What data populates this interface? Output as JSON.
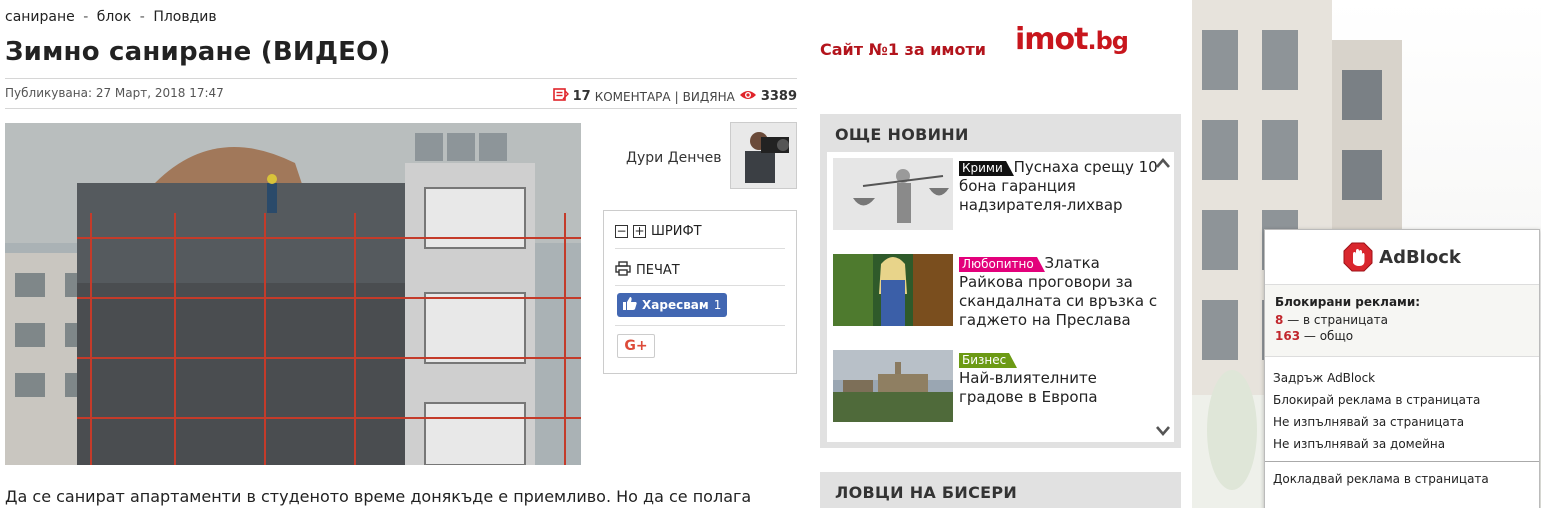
{
  "article": {
    "tags": [
      "саниране",
      "блок",
      "Пловдив"
    ],
    "tag_separator": "-",
    "title": "Зимно саниране (ВИДЕО)",
    "published": "Публикувана: 27 Март, 2018 17:47",
    "comments_count": "17",
    "comments_label": "КОМЕНТАРА",
    "stats_separator": "|",
    "views_label": "ВИДЯНА",
    "views_count": "3389",
    "author": "Дури Денчев",
    "lead": "Да се санират апартаменти в студеното време донякъде е приемливо. Но да се полага"
  },
  "tools": {
    "font_label": "ШРИФТ",
    "print_label": "ПЕЧАТ",
    "like_label": "Харесвам",
    "like_count": "1",
    "gplus_label": "G+"
  },
  "promo": {
    "text": "Сайт №1 за имоти",
    "logo_main": "imot",
    "logo_domain": ".bg"
  },
  "news": {
    "header": "ОЩЕ НОВИНИ",
    "items": [
      {
        "category": "Крими",
        "category_color": "#111111",
        "title": "Пуснаха срещу 10 бона гаранция надзирателя-лихвар"
      },
      {
        "category": "Любопитно",
        "category_color": "#e3007b",
        "title": "Златка Райкова проговори за скандалната си връзка с гаджето на Преслава"
      },
      {
        "category": "Бизнес",
        "category_color": "#6c9a14",
        "title": "Най-влиятелните градове в Европа"
      }
    ]
  },
  "hunters": {
    "header": "ЛОВЦИ НА БИСЕРИ"
  },
  "adblock": {
    "title": "AdBlock",
    "blocked_label": "Блокирани реклами:",
    "page_count": "8",
    "page_label": "— в страницата",
    "total_count": "163",
    "total_label": "— общо",
    "menu": [
      "Задръж AdBlock",
      "Блокирай реклама в страницата",
      "Не изпълнявай за страницата",
      "Не изпълнявай за домейна"
    ],
    "report": "Докладвай реклама в страницата"
  },
  "icons": [
    "comments-icon",
    "eye-icon",
    "font-decrease-icon",
    "font-increase-icon",
    "print-icon",
    "thumbs-up-icon",
    "chevron-up-icon",
    "chevron-down-icon",
    "adblock-hand-icon"
  ],
  "colors": {
    "brand_red": "#c8161d",
    "fb_blue": "#4267b2",
    "accent_red": "#e0242a"
  }
}
